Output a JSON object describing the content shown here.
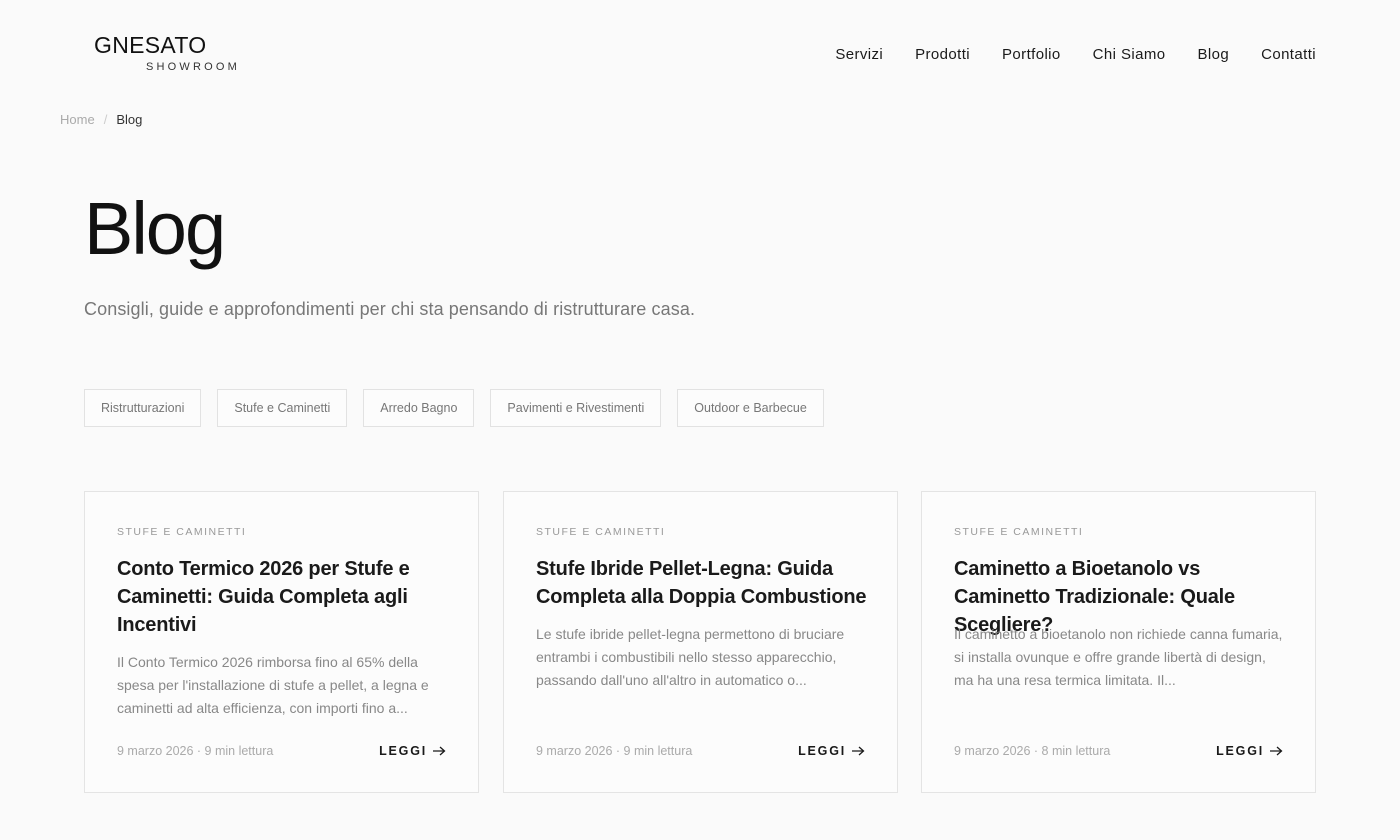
{
  "header": {
    "logo_main": "GNESATO",
    "logo_sub": "SHOWROOM",
    "nav": [
      "Servizi",
      "Prodotti",
      "Portfolio",
      "Chi Siamo",
      "Blog",
      "Contatti"
    ]
  },
  "breadcrumb": {
    "home": "Home",
    "separator": "/",
    "current": "Blog"
  },
  "page": {
    "title": "Blog",
    "subtitle": "Consigli, guide e approfondimenti per chi sta pensando di ristrutturare casa."
  },
  "filters": [
    "Ristrutturazioni",
    "Stufe e Caminetti",
    "Arredo Bagno",
    "Pavimenti e Rivestimenti",
    "Outdoor e Barbecue"
  ],
  "cards": [
    {
      "category": "STUFE E CAMINETTI",
      "title": "Conto Termico 2026 per Stufe e Caminetti: Guida Completa agli Incentivi",
      "excerpt": "Il Conto Termico 2026 rimborsa fino al 65% della spesa per l'installazione di stufe a pellet, a legna e caminetti ad alta efficienza, con importi fino a...",
      "meta": "9 marzo 2026 · 9 min lettura",
      "read": "LEGGI"
    },
    {
      "category": "STUFE E CAMINETTI",
      "title": "Stufe Ibride Pellet-Legna: Guida Completa alla Doppia Combustione",
      "excerpt": "Le stufe ibride pellet-legna permettono di bruciare entrambi i combustibili nello stesso apparecchio, passando dall'uno all'altro in automatico o...",
      "meta": "9 marzo 2026 · 9 min lettura",
      "read": "LEGGI"
    },
    {
      "category": "STUFE E CAMINETTI",
      "title": "Caminetto a Bioetanolo vs Caminetto Tradizionale: Quale Scegliere?",
      "excerpt": "Il caminetto a bioetanolo non richiede canna fumaria, si installa ovunque e offre grande libertà di design, ma ha una resa termica limitata. Il...",
      "meta": "9 marzo 2026 · 8 min lettura",
      "read": "LEGGI"
    }
  ]
}
